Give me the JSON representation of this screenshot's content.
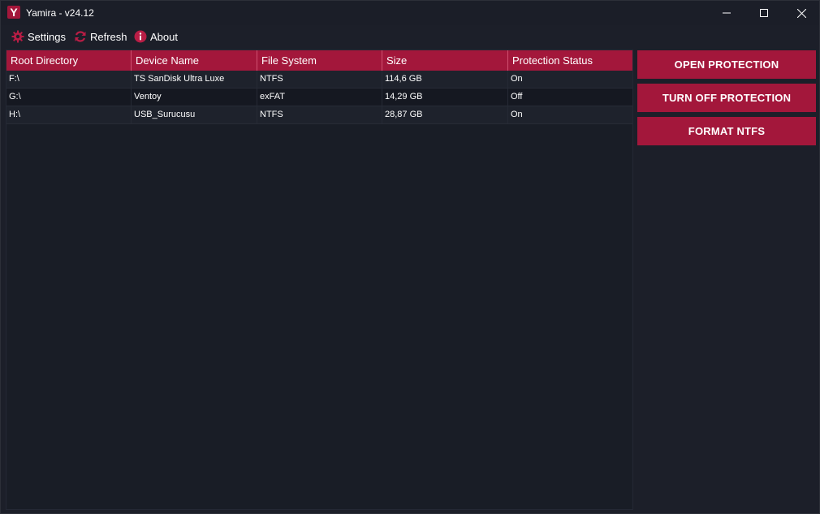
{
  "window": {
    "title": "Yamira - v24.12",
    "app_icon_letter": "Y"
  },
  "menu": {
    "settings_label": "Settings",
    "refresh_label": "Refresh",
    "about_label": "About"
  },
  "table": {
    "columns": [
      "Root Directory",
      "Device Name",
      "File System",
      "Size",
      "Protection Status"
    ],
    "rows": [
      [
        "F:\\",
        "TS SanDisk Ultra Luxe",
        "NTFS",
        "114,6 GB",
        "On"
      ],
      [
        "G:\\",
        "Ventoy",
        "exFAT",
        "14,29 GB",
        "Off"
      ],
      [
        "H:\\",
        "USB_Surucusu",
        "NTFS",
        "28,87 GB",
        "On"
      ]
    ]
  },
  "actions": {
    "open_protection": "OPEN PROTECTION",
    "turn_off_protection": "TURN OFF PROTECTION",
    "format_ntfs": "FORMAT NTFS"
  },
  "colors": {
    "accent": "#a3173b",
    "background": "#1c1f29"
  },
  "icons": {
    "settings": "gear-icon",
    "refresh": "refresh-icon",
    "about": "info-icon"
  }
}
